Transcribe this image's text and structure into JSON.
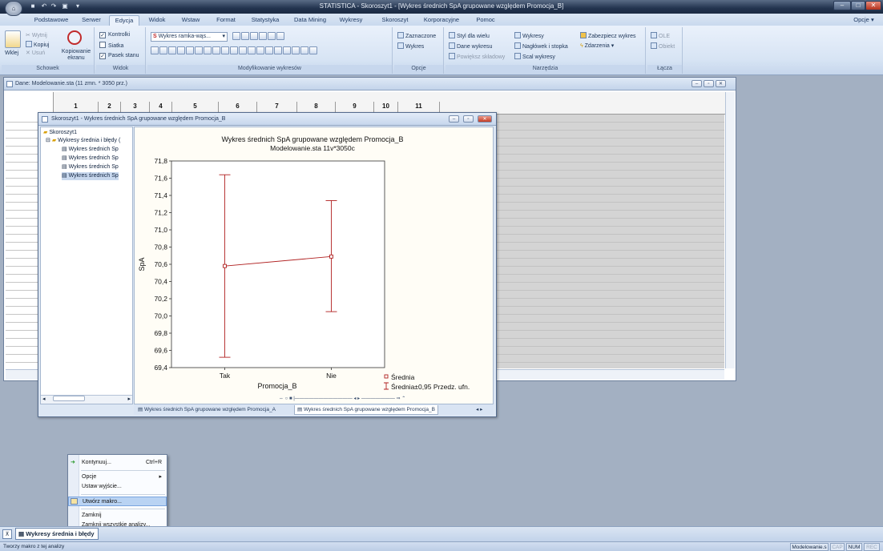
{
  "titlebar": {
    "title": "STATISTICA - Skoroszyt1 - [Wykres średnich  SpA grupowane względem Promocja_B]",
    "options": "Opcje"
  },
  "tabs": [
    "Podstawowe",
    "Serwer",
    "Edycja",
    "Widok",
    "Wstaw",
    "Format",
    "Statystyka",
    "Data Mining",
    "Wykresy",
    "Skoroszyt",
    "Korporacyjne",
    "Pomoc"
  ],
  "ribbon": {
    "clipboard": {
      "paste": "Wklej",
      "cut": "Wytnij",
      "copy": "Kopiuj",
      "delete": "Usuń",
      "screen_copy": "Kopiowanie ekranu",
      "label": "Schowek"
    },
    "view": {
      "controls": "Kontrolki",
      "grid": "Siatka",
      "statusbar": "Pasek stanu",
      "label": "Widok"
    },
    "graph_edit": {
      "combo": "Wykres ramka-wąs...",
      "label": "Modyfikowanie wykresów"
    },
    "options": {
      "selected": "Zaznaczone",
      "graph": "Wykres",
      "label": "Opcje"
    },
    "tools": {
      "multi_style": "Styl dla wielu",
      "graph_data": "Dane wykresu",
      "zoom_comp": "Powiększ składowy",
      "graphs": "Wykresy",
      "header_footer": "Nagłówek i stopka",
      "merge": "Scal wykresy",
      "protect": "Zabezpiecz wykres",
      "events": "Zdarzenia",
      "label": "Narzędzia"
    },
    "links": {
      "ole": "OLE",
      "object": "Obiekt",
      "label": "Łącza"
    }
  },
  "datawin": {
    "title": "Dane: Modelowanie.sta (11 zmn. * 3050 prz.)",
    "cols": [
      "1",
      "2",
      "3",
      "4",
      "5",
      "6",
      "7",
      "8",
      "9",
      "10",
      "11"
    ]
  },
  "workbook": {
    "title": "Skoroszyt1 - Wykres średnich  SpA grupowane względem Promocja_B",
    "tree": {
      "root": "Skoroszyt1",
      "folder": "Wykresy średnia i błędy (",
      "items": [
        "Wykres średnich  Sp",
        "Wykres średnich  Sp",
        "Wykres średnich  Sp",
        "Wykres średnich  Sp"
      ]
    },
    "tabs": [
      "Wykres średnich  SpA grupowane względem Promocja_A",
      "Wykres średnich  SpA grupowane względem Promocja_B"
    ]
  },
  "chart_data": {
    "type": "line",
    "title": "Wykres średnich   SpA grupowane względem Promocja_B",
    "subtitle": "Modelowanie.sta 11v*3050c",
    "xlabel": "Promocja_B",
    "ylabel": "SpA",
    "categories": [
      "Tak",
      "Nie"
    ],
    "ylim": [
      69.4,
      71.8
    ],
    "yticks": [
      "71,8",
      "71,6",
      "71,4",
      "71,2",
      "71,0",
      "70,8",
      "70,6",
      "70,4",
      "70,2",
      "70,0",
      "69,8",
      "69,6",
      "69,4"
    ],
    "series": [
      {
        "name": "Średnia",
        "values": [
          70.58,
          70.69
        ],
        "lower": [
          69.52,
          70.05
        ],
        "upper": [
          71.64,
          71.34
        ]
      }
    ],
    "legend": [
      "Średnia",
      "Średnia±0,95 Przedz. ufn."
    ],
    "color": "#b02020"
  },
  "context_menu": {
    "items": [
      {
        "label": "Kontynuuj...",
        "shortcut": "Ctrl+R"
      },
      {
        "label": "Opcje",
        "shortcut": ""
      },
      {
        "label": "Ustaw wyjście...",
        "shortcut": ""
      },
      {
        "label": "Utwórz makro...",
        "shortcut": ""
      },
      {
        "label": "Zamknij",
        "shortcut": ""
      },
      {
        "label": "Zamknij wszystkie analizy...",
        "shortcut": ""
      }
    ]
  },
  "taskbar": {
    "item": "Wykresy średnia i błędy"
  },
  "statusbar": {
    "text": "Tworzy makro z tej analizy",
    "file": "Modelowanie.s",
    "cap": "CAP",
    "num": "NUM",
    "rec": "REC"
  }
}
